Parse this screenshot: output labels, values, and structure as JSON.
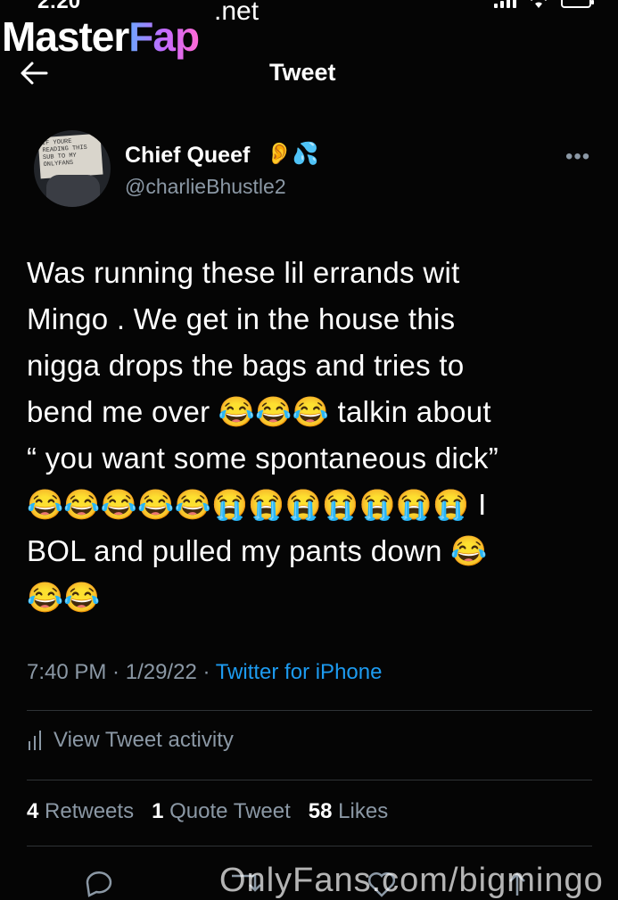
{
  "status_bar": {
    "time": "2:20"
  },
  "watermark": {
    "brand_master": "Master",
    "brand_fap": "Fap",
    "brand_tld": ".net",
    "footer": "OnlyFans.com/bigmingo"
  },
  "header": {
    "back_icon": "back-arrow-icon",
    "title": "Tweet"
  },
  "author": {
    "display_name": "Chief Queef",
    "name_emojis": "👂💦",
    "handle": "@charlieBhustle2",
    "avatar_sign_text": "IF YOURE READING THIS SUB TO MY ONLYFANS"
  },
  "tweet": {
    "text": "Was running these lil errands wit\nMingo . We get in the house this\nnigga drops the bags and tries to\nbend me over 😂😂😂 talkin about\n“ you want some spontaneous dick”\n😂😂😂😂😂😭😭😭😭😭😭😭 I\nBOL and pulled my pants down 😂\n😂😂",
    "time": "7:40 PM",
    "date": "1/29/22",
    "source": "Twitter for iPhone"
  },
  "activity": {
    "icon": "bar-chart-icon",
    "label": "View Tweet activity"
  },
  "stats": {
    "retweets_count": "4",
    "retweets_label": "Retweets",
    "quotes_count": "1",
    "quotes_label": "Quote Tweet",
    "likes_count": "58",
    "likes_label": "Likes"
  },
  "colors": {
    "background": "#050505",
    "secondary_text": "#8b98a5",
    "link": "#1d9bf0",
    "divider": "#2f3336"
  }
}
